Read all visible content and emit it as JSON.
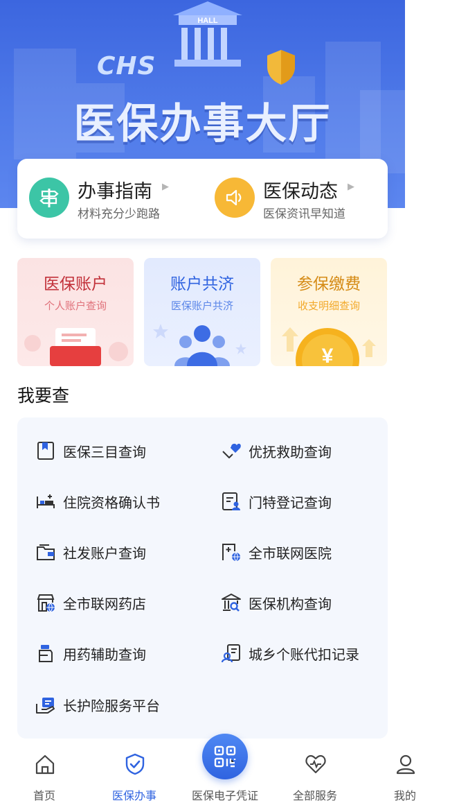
{
  "hero": {
    "title": "医保办事大厅",
    "badge_text": "HALL",
    "logo_text": "CHS"
  },
  "quick": [
    {
      "title": "办事指南",
      "subtitle": "材料充分少跑路",
      "icon": "signpost-icon",
      "color": "#3cc5a6"
    },
    {
      "title": "医保动态",
      "subtitle": "医保资讯早知道",
      "icon": "speaker-icon",
      "color": "#f7b836"
    }
  ],
  "features": [
    {
      "title": "医保账户",
      "subtitle": "个人账户查询",
      "icon": "wallet-illustration"
    },
    {
      "title": "账户共济",
      "subtitle": "医保账户共济",
      "icon": "family-illustration"
    },
    {
      "title": "参保缴费",
      "subtitle": "收支明细查询",
      "icon": "coin-illustration"
    }
  ],
  "section": {
    "title": "我要查"
  },
  "query_items": [
    {
      "label": "医保三目查询",
      "icon": "bookmark-doc-icon"
    },
    {
      "label": "优抚救助查询",
      "icon": "heart-hand-icon"
    },
    {
      "label": "住院资格确认书",
      "icon": "hospital-bed-icon"
    },
    {
      "label": "门特登记查询",
      "icon": "doc-person-icon"
    },
    {
      "label": "社发账户查询",
      "icon": "folder-wallet-icon"
    },
    {
      "label": "全市联网医院",
      "icon": "hospital-network-icon"
    },
    {
      "label": "全市联网药店",
      "icon": "pharmacy-network-icon"
    },
    {
      "label": "医保机构查询",
      "icon": "institution-search-icon"
    },
    {
      "label": "用药辅助查询",
      "icon": "medicine-bottle-icon"
    },
    {
      "label": "城乡个账代扣记录",
      "icon": "person-record-icon"
    },
    {
      "label": "长护险服务平台",
      "icon": "care-hand-icon"
    }
  ],
  "tabs": [
    {
      "label": "首页",
      "icon": "home-icon"
    },
    {
      "label": "医保办事",
      "icon": "shield-check-icon",
      "active": true
    },
    {
      "label": "医保电子凭证",
      "icon": "qr-code-icon"
    },
    {
      "label": "全部服务",
      "icon": "heart-pulse-icon"
    },
    {
      "label": "我的",
      "icon": "user-icon"
    }
  ],
  "colors": {
    "primary": "#2f63e0",
    "hero_bg": "#4f7ae9",
    "card_red_bg": "#fde8e8",
    "card_blue_bg": "#e6eeff",
    "card_yellow_bg": "#fff5dd"
  }
}
